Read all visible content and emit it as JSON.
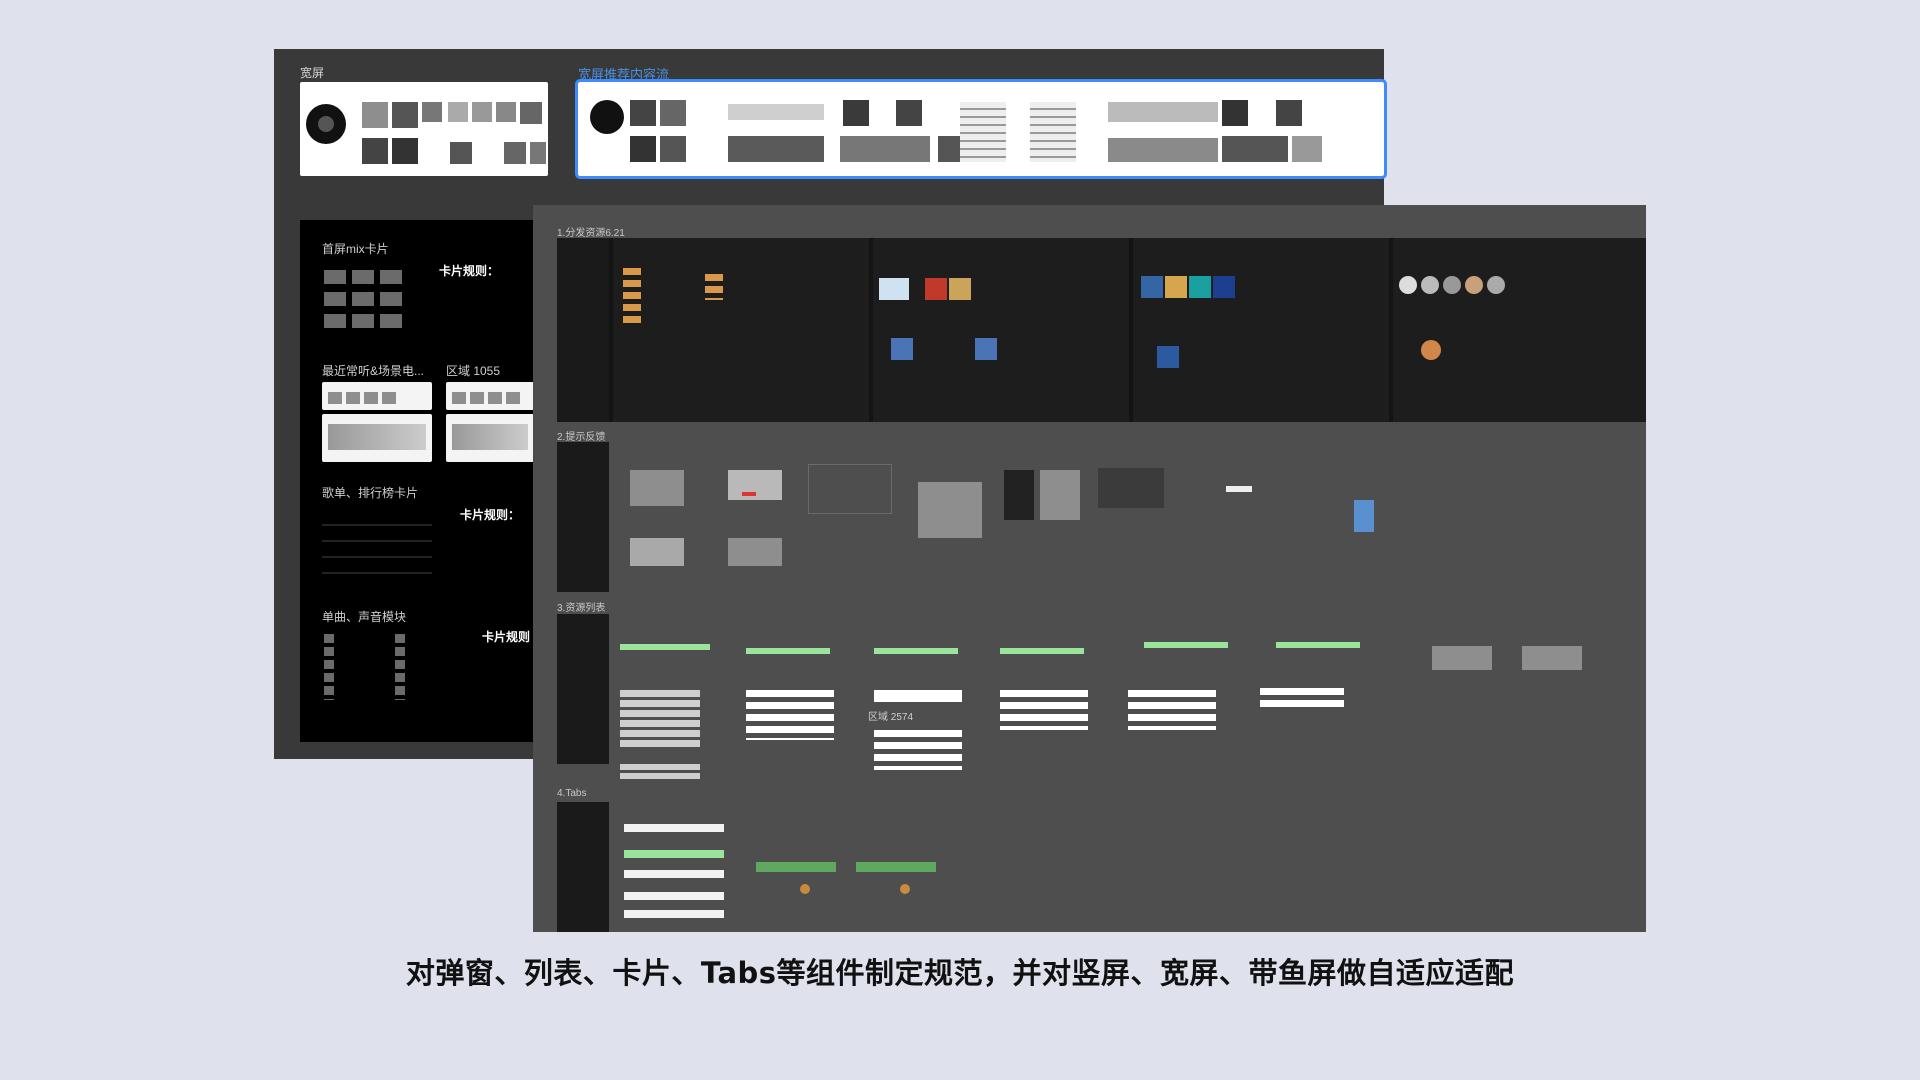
{
  "top_board": {
    "label_wide": "宽屏",
    "label_feed": "宽屏推荐内容流"
  },
  "black_panel": {
    "mix_title": "首屏mix卡片",
    "rule_1": "卡片规则：",
    "recent_title": "最近常听&场景电...",
    "region_label": "区域 1055",
    "playlist_title": "歌单、排行榜卡片",
    "rule_2": "卡片规则：",
    "single_title": "单曲、声音模块",
    "rule_3": "卡片规则"
  },
  "main_board": {
    "sections": [
      {
        "label": "1.分发资源6.21"
      },
      {
        "label": "2.提示反馈"
      },
      {
        "label": "3.资源列表"
      },
      {
        "label": "4.Tabs"
      }
    ],
    "region_2574": "区域 2574"
  },
  "caption": "对弹窗、列表、卡片、Tabs等组件制定规范，并对竖屏、宽屏、带鱼屏做自适应适配",
  "colors": {
    "background": "#dfe2ec",
    "board_dark": "#393939",
    "board_main": "#4e4e4e",
    "selection": "#3d8bfd",
    "accent_green": "#9be59b"
  }
}
